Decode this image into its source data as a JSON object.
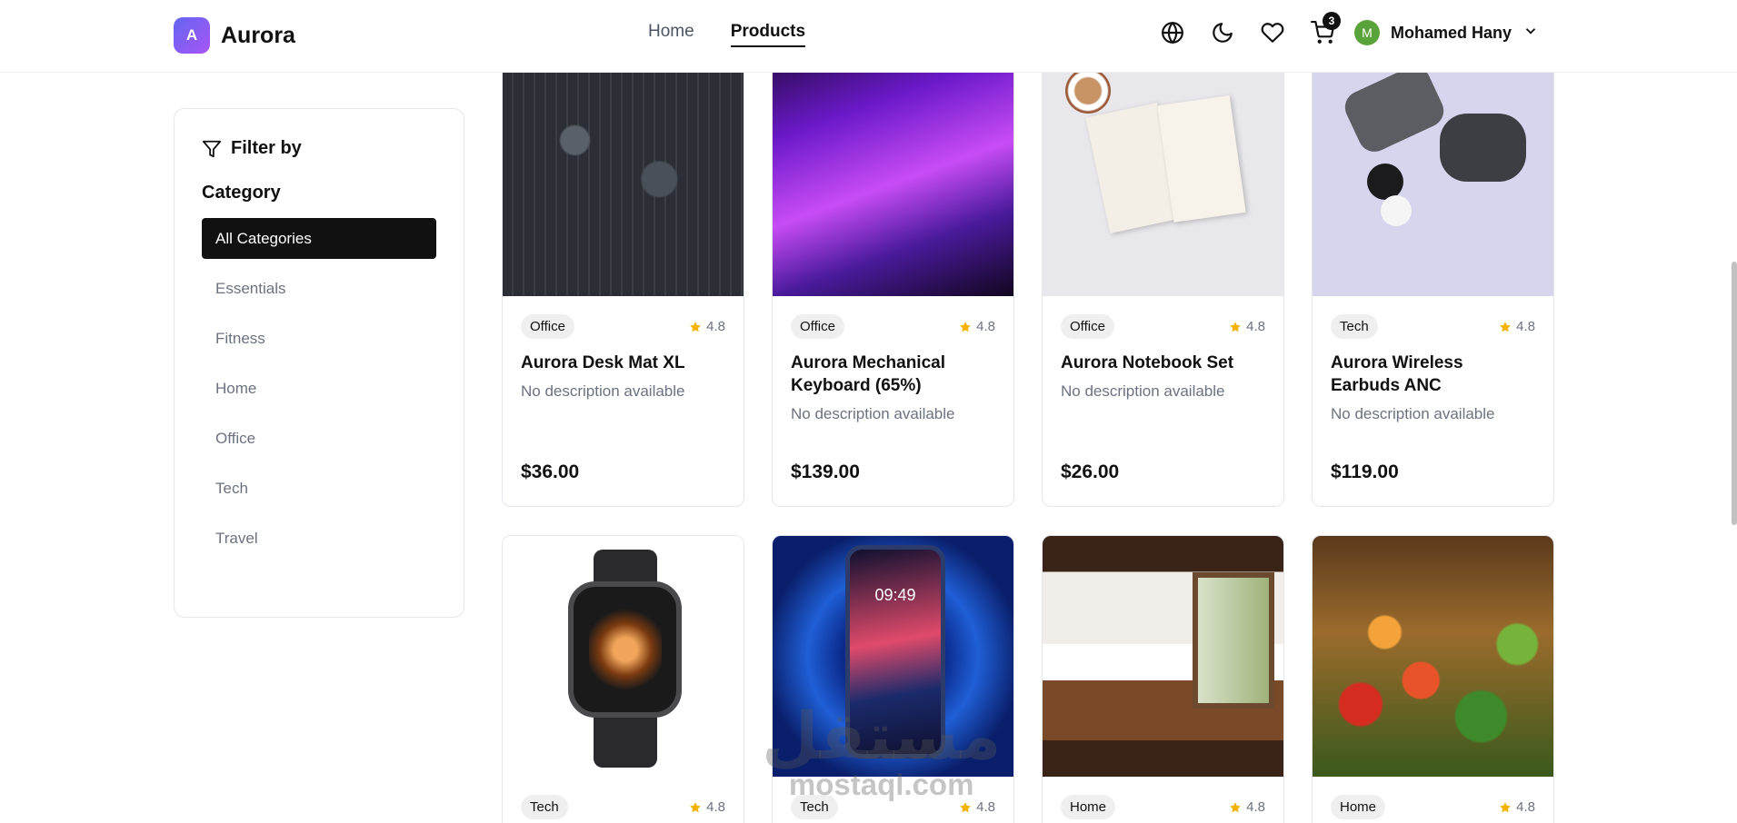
{
  "header": {
    "logo_letter": "A",
    "brand": "Aurora",
    "nav": [
      {
        "label": "Home",
        "active": false
      },
      {
        "label": "Products",
        "active": true
      }
    ],
    "cart_count": "3",
    "user": {
      "initial": "M",
      "name": "Mohamed Hany"
    },
    "icons": [
      "globe-icon",
      "moon-icon",
      "heart-icon",
      "cart-icon",
      "chevron-down-icon"
    ]
  },
  "sidebar": {
    "filter_title": "Filter by",
    "category_heading": "Category",
    "categories": [
      "All Categories",
      "Essentials",
      "Fitness",
      "Home",
      "Office",
      "Tech",
      "Travel"
    ],
    "selected": "All Categories"
  },
  "products": [
    {
      "tag": "Office",
      "rating": "4.8",
      "name": "Aurora Desk Mat XL",
      "desc": "No description available",
      "price": "$36.00"
    },
    {
      "tag": "Office",
      "rating": "4.8",
      "name": "Aurora Mechanical Keyboard (65%)",
      "desc": "No description available",
      "price": "$139.00"
    },
    {
      "tag": "Office",
      "rating": "4.8",
      "name": "Aurora Notebook Set",
      "desc": "No description available",
      "price": "$26.00"
    },
    {
      "tag": "Tech",
      "rating": "4.8",
      "name": "Aurora Wireless Earbuds ANC",
      "desc": "No description available",
      "price": "$119.00"
    },
    {
      "tag": "Tech",
      "rating": "4.8"
    },
    {
      "tag": "Tech",
      "rating": "4.8",
      "phone_time": "09:49"
    },
    {
      "tag": "Home",
      "rating": "4.8"
    },
    {
      "tag": "Home",
      "rating": "4.8"
    }
  ],
  "watermark": {
    "ar": "مستقل",
    "en": "mostaql.com"
  },
  "colors": {
    "accent": "#111111",
    "star": "#f5b301",
    "brand_start": "#6366f1",
    "brand_end": "#a855f7",
    "avatar": "#5aa33a"
  }
}
